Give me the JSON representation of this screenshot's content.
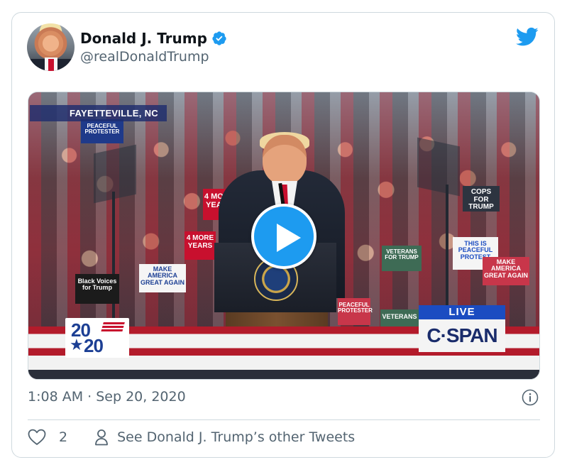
{
  "tweet": {
    "display_name": "Donald J. Trump",
    "handle": "@realDonaldTrump",
    "verified": true,
    "timestamp": "1:08 AM · Sep 20, 2020",
    "like_count": "2",
    "profile_link_text": "See Donald J. Trump’s other Tweets"
  },
  "video": {
    "location_label": "FAYETTEVILLE, NC",
    "live_label": "LIVE",
    "network_label": "C·SPAN",
    "event_logo_top": "20",
    "event_logo_bottom": "20",
    "signs": [
      "PEACEFUL PROTESTER",
      "4 MORE YEARS",
      "4 MORE YEARS",
      "MAKE AMERICA GREAT AGAIN",
      "Black Voices for Trump",
      "THIS IS PEACEFUL PROTEST",
      "COPS FOR TRUMP",
      "MAKE AMERICA GREAT AGAIN",
      "VETERANS FOR TRUMP",
      "VETERANS",
      "PEACEFUL PROTESTER"
    ]
  },
  "icons": {
    "avatar": "profile-photo",
    "verified": "verified-badge-icon",
    "brand": "twitter-bird-icon",
    "play": "play-icon",
    "info": "info-icon",
    "like": "heart-icon",
    "profile": "person-icon"
  },
  "colors": {
    "accent": "#1d9bf0",
    "text_primary": "#0f1419",
    "text_secondary": "#536471",
    "border": "#cfd9de"
  }
}
